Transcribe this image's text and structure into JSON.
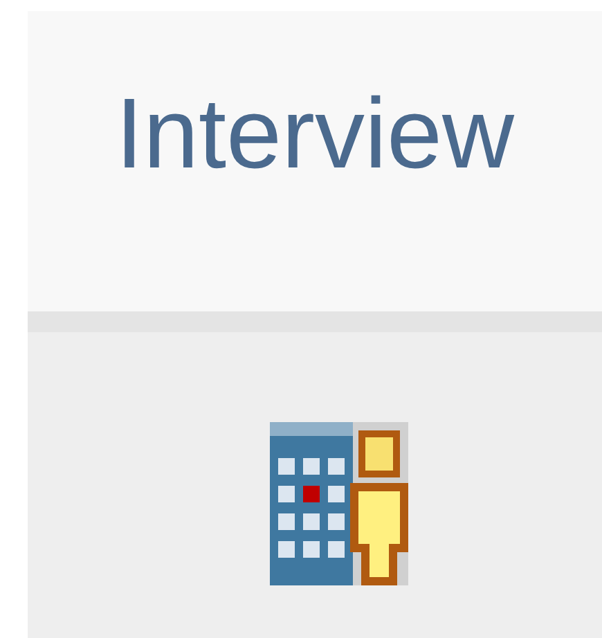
{
  "title": "Interview"
}
